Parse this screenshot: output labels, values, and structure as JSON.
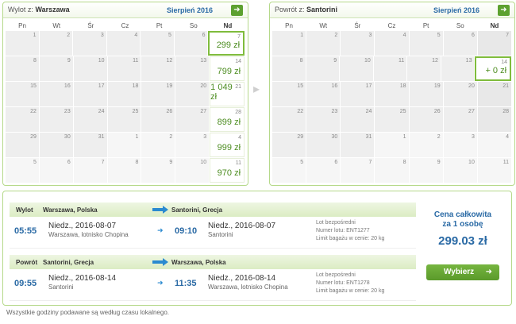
{
  "outbound_calendar": {
    "route_label": "Wylot z:",
    "route_city": "Warszawa",
    "month": "Sierpień 2016",
    "next_icon": "arrow-right-icon",
    "days_of_week": [
      "Pn",
      "Wt",
      "Śr",
      "Cz",
      "Pt",
      "So",
      "Nd"
    ],
    "weeks": [
      [
        {
          "d": "1"
        },
        {
          "d": "2"
        },
        {
          "d": "3"
        },
        {
          "d": "4"
        },
        {
          "d": "5"
        },
        {
          "d": "6"
        },
        {
          "d": "7",
          "p": "299 zł",
          "sel": true
        }
      ],
      [
        {
          "d": "8"
        },
        {
          "d": "9"
        },
        {
          "d": "10"
        },
        {
          "d": "11"
        },
        {
          "d": "12"
        },
        {
          "d": "13"
        },
        {
          "d": "14",
          "p": "799 zł"
        }
      ],
      [
        {
          "d": "15"
        },
        {
          "d": "16"
        },
        {
          "d": "17"
        },
        {
          "d": "18"
        },
        {
          "d": "19"
        },
        {
          "d": "20"
        },
        {
          "d": "21",
          "p": "1 049 zł"
        }
      ],
      [
        {
          "d": "22"
        },
        {
          "d": "23"
        },
        {
          "d": "24"
        },
        {
          "d": "25"
        },
        {
          "d": "26"
        },
        {
          "d": "27"
        },
        {
          "d": "28",
          "p": "899 zł"
        }
      ],
      [
        {
          "d": "29"
        },
        {
          "d": "30"
        },
        {
          "d": "31"
        },
        {
          "d": "1",
          "e": true
        },
        {
          "d": "2",
          "e": true
        },
        {
          "d": "3",
          "e": true
        },
        {
          "d": "4",
          "p": "999 zł"
        }
      ],
      [
        {
          "d": "5",
          "e": true
        },
        {
          "d": "6",
          "e": true
        },
        {
          "d": "7",
          "e": true
        },
        {
          "d": "8",
          "e": true
        },
        {
          "d": "9",
          "e": true
        },
        {
          "d": "10",
          "e": true
        },
        {
          "d": "11",
          "p": "970 zł"
        }
      ]
    ]
  },
  "return_calendar": {
    "route_label": "Powrót z:",
    "route_city": "Santorini",
    "month": "Sierpień 2016",
    "next_icon": "arrow-right-icon",
    "days_of_week": [
      "Pn",
      "Wt",
      "Śr",
      "Cz",
      "Pt",
      "So",
      "Nd"
    ],
    "weeks": [
      [
        {
          "d": "1"
        },
        {
          "d": "2"
        },
        {
          "d": "3"
        },
        {
          "d": "4"
        },
        {
          "d": "5"
        },
        {
          "d": "6"
        },
        {
          "d": "7"
        }
      ],
      [
        {
          "d": "8"
        },
        {
          "d": "9"
        },
        {
          "d": "10"
        },
        {
          "d": "11"
        },
        {
          "d": "12"
        },
        {
          "d": "13"
        },
        {
          "d": "14",
          "p": "+ 0 zł",
          "sel": true
        }
      ],
      [
        {
          "d": "15"
        },
        {
          "d": "16"
        },
        {
          "d": "17"
        },
        {
          "d": "18"
        },
        {
          "d": "19"
        },
        {
          "d": "20"
        },
        {
          "d": "21"
        }
      ],
      [
        {
          "d": "22"
        },
        {
          "d": "23"
        },
        {
          "d": "24"
        },
        {
          "d": "25"
        },
        {
          "d": "26"
        },
        {
          "d": "27"
        },
        {
          "d": "28"
        }
      ],
      [
        {
          "d": "29"
        },
        {
          "d": "30"
        },
        {
          "d": "31"
        },
        {
          "d": "1",
          "e": true
        },
        {
          "d": "2",
          "e": true
        },
        {
          "d": "3",
          "e": true
        },
        {
          "d": "4",
          "e": true
        }
      ],
      [
        {
          "d": "5",
          "e": true
        },
        {
          "d": "6",
          "e": true
        },
        {
          "d": "7",
          "e": true
        },
        {
          "d": "8",
          "e": true
        },
        {
          "d": "9",
          "e": true
        },
        {
          "d": "10",
          "e": true
        },
        {
          "d": "11",
          "e": true
        }
      ]
    ]
  },
  "outbound": {
    "label": "Wylot",
    "from": "Warszawa, Polska",
    "to": "Santorini, Grecja",
    "dep_time": "05:55",
    "dep_date": "Niedz., 2016-08-07",
    "dep_place": "Warszawa, lotnisko Chopina",
    "arr_time": "09:10",
    "arr_date": "Niedz., 2016-08-07",
    "arr_place": "Santorini",
    "info_direct": "Lot bezpośredni",
    "info_flight": "Numer lotu: ENT1277",
    "info_baggage": "Limit bagażu w cenie: 20 kg"
  },
  "inbound": {
    "label": "Powrót",
    "from": "Santorini, Grecja",
    "to": "Warszawa, Polska",
    "dep_time": "09:55",
    "dep_date": "Niedz., 2016-08-14",
    "dep_place": "Santorini",
    "arr_time": "11:35",
    "arr_date": "Niedz., 2016-08-14",
    "arr_place": "Warszawa, lotnisko Chopina",
    "info_direct": "Lot bezpośredni",
    "info_flight": "Numer lotu: ENT1278",
    "info_baggage": "Limit bagażu w cenie: 20 kg"
  },
  "price_box": {
    "title_line1": "Cena całkowita",
    "title_line2": "za 1 osobę",
    "total": "299.03 zł",
    "button_label": "Wybierz",
    "button_icon": "arrow-right-icon"
  },
  "footer_note": "Wszystkie godziny podawane są według czasu lokalnego.",
  "colors": {
    "accent_green": "#5da130",
    "link_blue": "#2a6aa5",
    "arrow_blue": "#2a8ad0",
    "border_green": "#b5d98a"
  }
}
